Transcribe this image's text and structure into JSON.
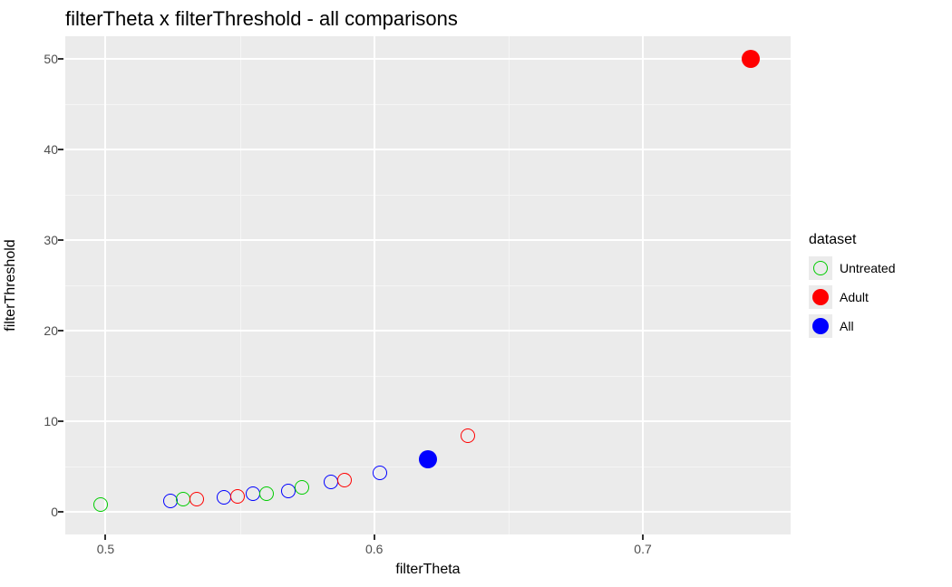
{
  "chart_data": {
    "type": "scatter",
    "title": "filterTheta x filterThreshold - all comparisons",
    "xlabel": "filterTheta",
    "ylabel": "filterThreshold",
    "xlim": [
      0.485,
      0.755
    ],
    "ylim": [
      -2.5,
      52.5
    ],
    "x_ticks": [
      0.5,
      0.6,
      0.7
    ],
    "y_ticks": [
      0,
      10,
      20,
      30,
      40,
      50
    ],
    "legend_title": "dataset",
    "series": [
      {
        "name": "Untreated",
        "color": "#00cc00",
        "filled": false,
        "radius": 7
      },
      {
        "name": "Adult",
        "color": "#ff0000",
        "filled": true,
        "radius": 10
      },
      {
        "name": "All",
        "color": "#0000ff",
        "filled": true,
        "radius": 10
      }
    ],
    "points": [
      {
        "x": 0.498,
        "y": 0.8,
        "series": "Untreated"
      },
      {
        "x": 0.524,
        "y": 1.2,
        "series": "All"
      },
      {
        "x": 0.529,
        "y": 1.4,
        "series": "Untreated"
      },
      {
        "x": 0.534,
        "y": 1.4,
        "series": "Adult"
      },
      {
        "x": 0.544,
        "y": 1.6,
        "series": "All"
      },
      {
        "x": 0.549,
        "y": 1.7,
        "series": "Adult"
      },
      {
        "x": 0.555,
        "y": 2.0,
        "series": "All"
      },
      {
        "x": 0.56,
        "y": 2.0,
        "series": "Untreated"
      },
      {
        "x": 0.568,
        "y": 2.3,
        "series": "All"
      },
      {
        "x": 0.573,
        "y": 2.7,
        "series": "Untreated"
      },
      {
        "x": 0.584,
        "y": 3.3,
        "series": "All"
      },
      {
        "x": 0.589,
        "y": 3.5,
        "series": "Adult"
      },
      {
        "x": 0.602,
        "y": 4.3,
        "series": "All"
      },
      {
        "x": 0.62,
        "y": 5.8,
        "series": "All",
        "big": true
      },
      {
        "x": 0.635,
        "y": 8.4,
        "series": "Adult"
      },
      {
        "x": 0.74,
        "y": 50.0,
        "series": "Adult",
        "big": true
      }
    ]
  }
}
